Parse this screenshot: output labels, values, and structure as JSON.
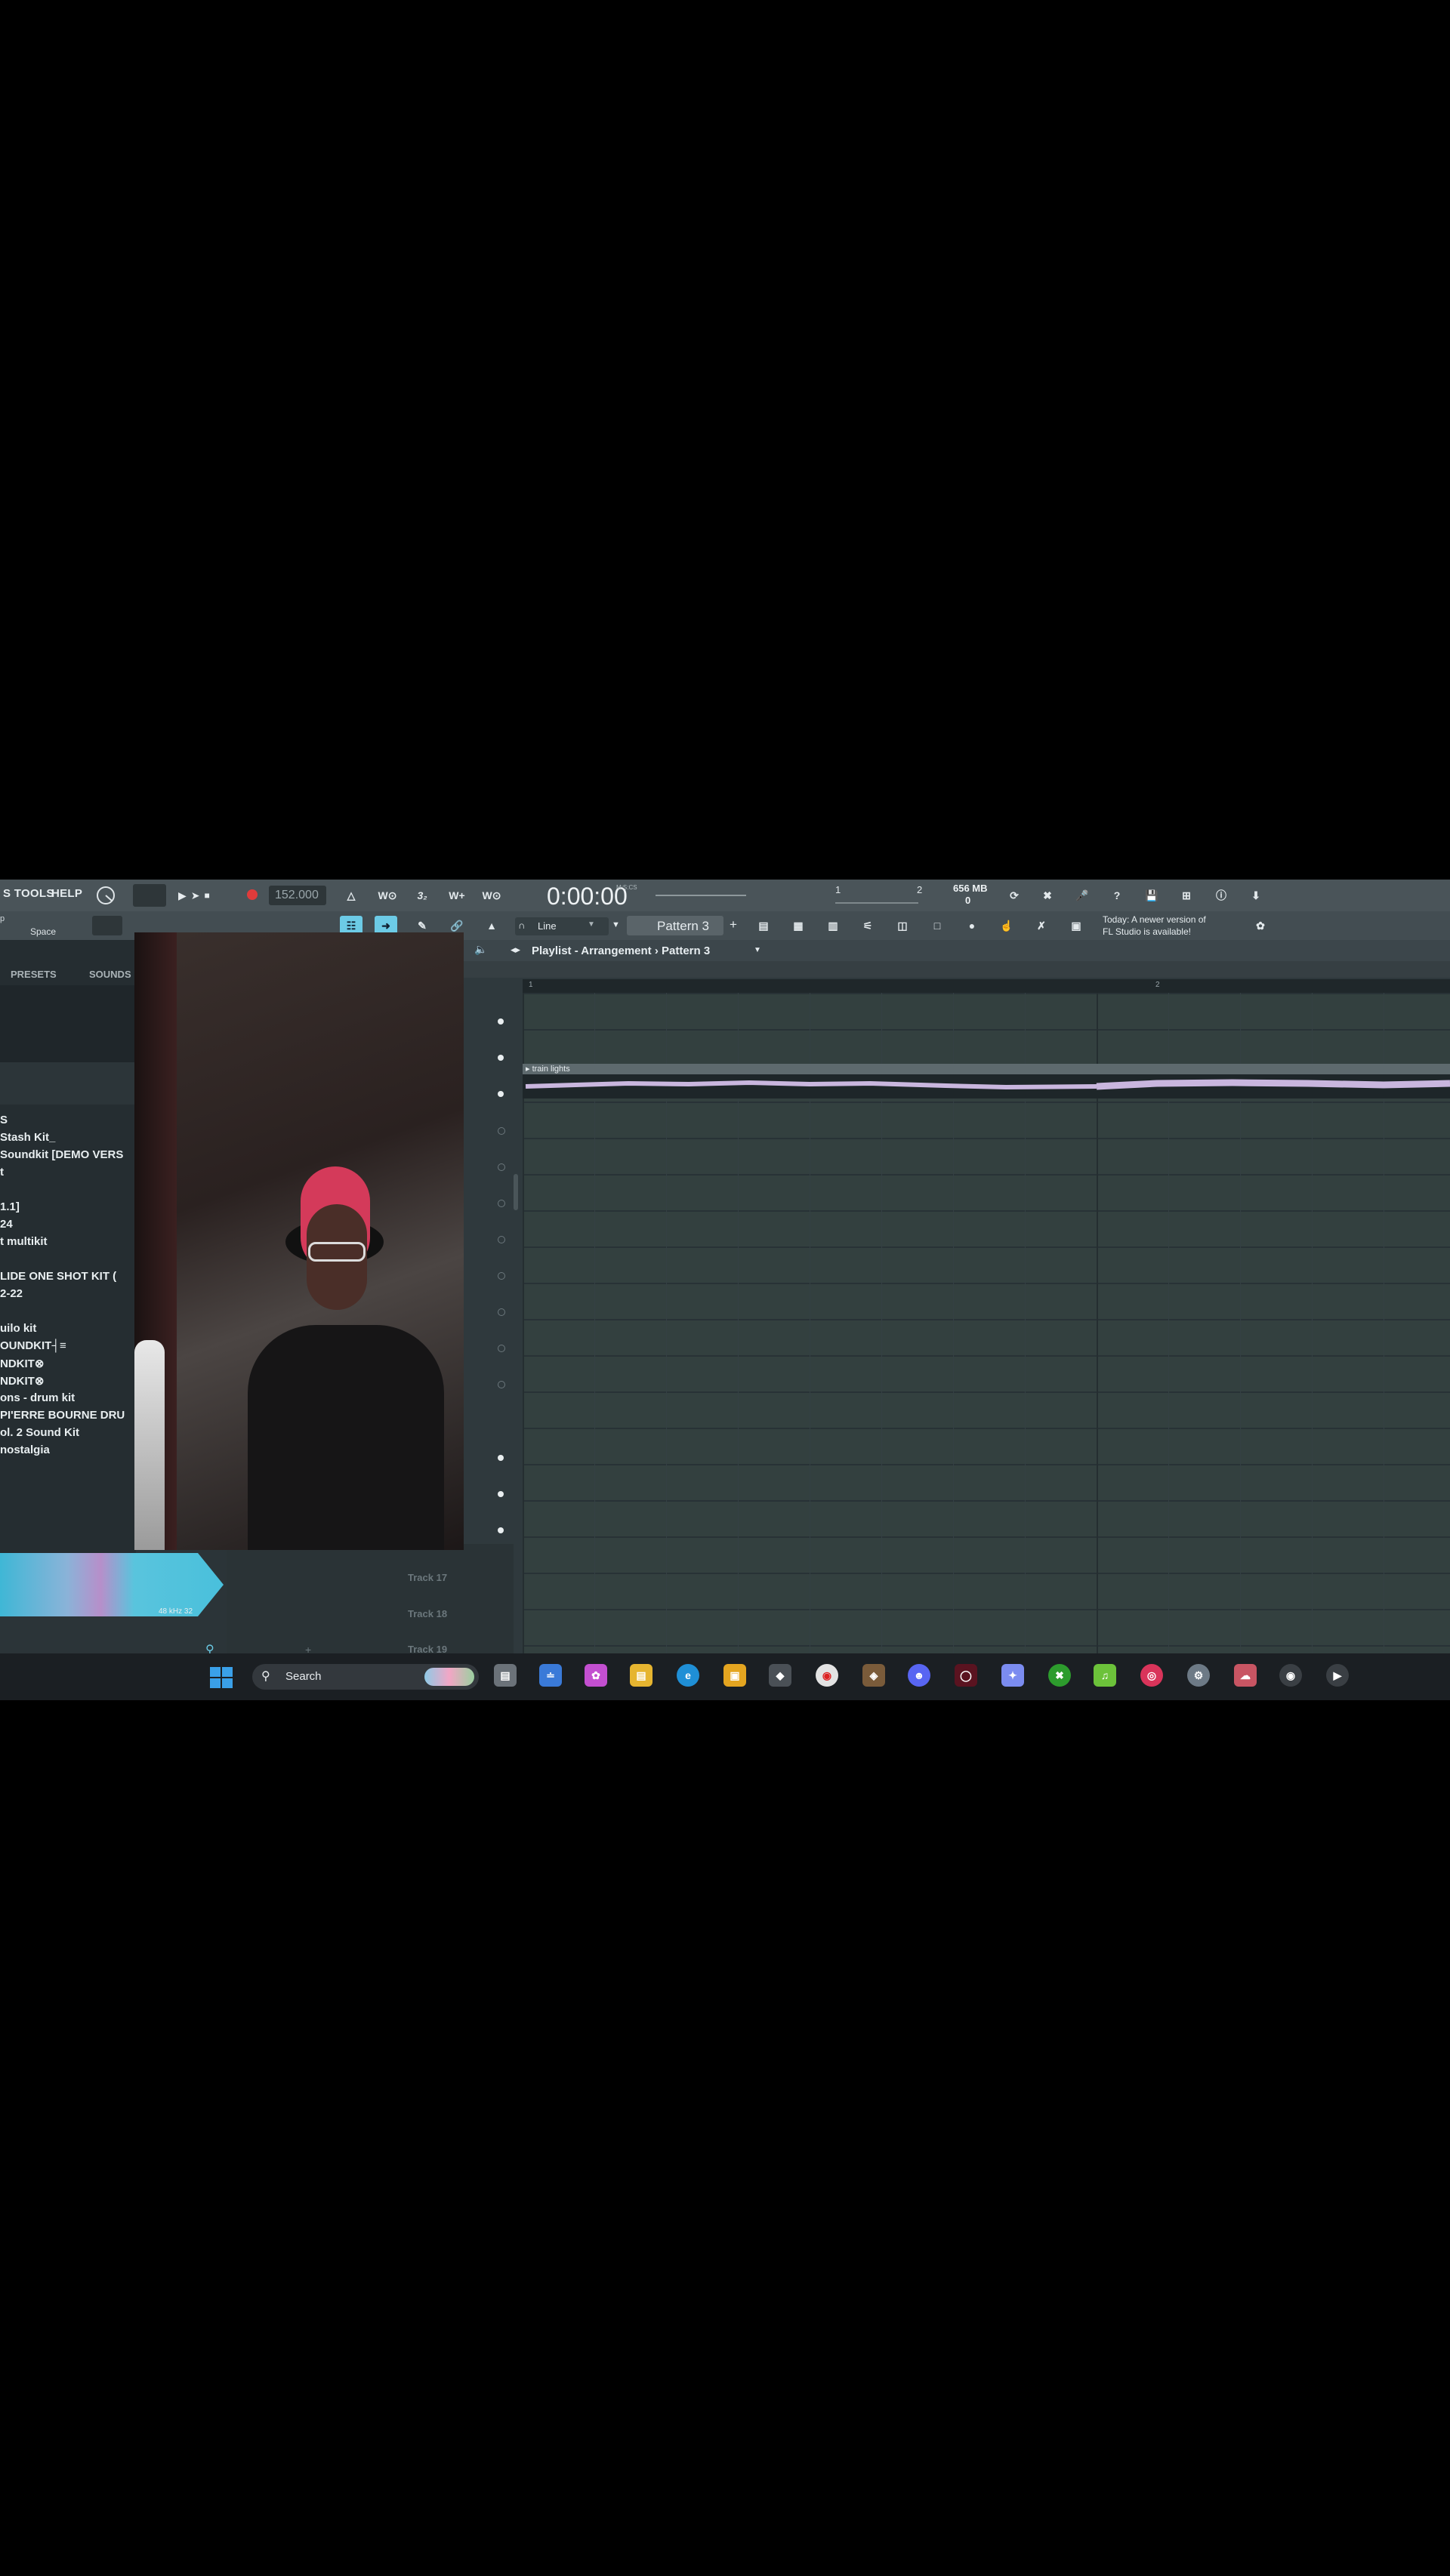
{
  "menu": {
    "tools": "S TOOLS",
    "help": "HELP"
  },
  "transport": {
    "tempo": "152.000",
    "time": "0:00:00",
    "time_unit": "M:S:CS",
    "pattern": "Pattern 3",
    "snap": "Line",
    "cpu_label": "1",
    "poly_label": "2",
    "memory": "656 MB",
    "voices": "0"
  },
  "hint": {
    "key": "Space",
    "update_line1": "Today: A newer version of",
    "update_line2": "FL Studio is available!"
  },
  "browser": {
    "tabs": [
      "PRESETS",
      "SOUNDS"
    ],
    "items": [
      "S",
      "Stash Kit_",
      "Soundkit [DEMO VERS",
      "t",
      "",
      "1.1]",
      "24",
      "t multikit",
      "",
      "LIDE ONE SHOT KIT (",
      "2-22",
      "",
      "uilo kit",
      "OUNDKIT┤≡",
      "NDKIT⊗",
      "NDKIT⊗",
      "ons - drum kit",
      "PI'ERRE BOURNE DRU",
      "ol. 2 Sound Kit",
      "nostalgia"
    ],
    "waveform_info": "48 kHz 32"
  },
  "playlist": {
    "title": "Playlist - Arrangement › Pattern 3",
    "ruler": [
      "1",
      "2"
    ],
    "clip_label": "▸ train lights",
    "tracks": [
      "Track 17",
      "Track 18",
      "Track 19"
    ]
  },
  "taskbar": {
    "search_placeholder": "Search"
  },
  "colors": {
    "accent": "#6ccbe6",
    "clip": "#c9b6de",
    "background": "#2b3438",
    "waveform": "#58c6e0"
  }
}
